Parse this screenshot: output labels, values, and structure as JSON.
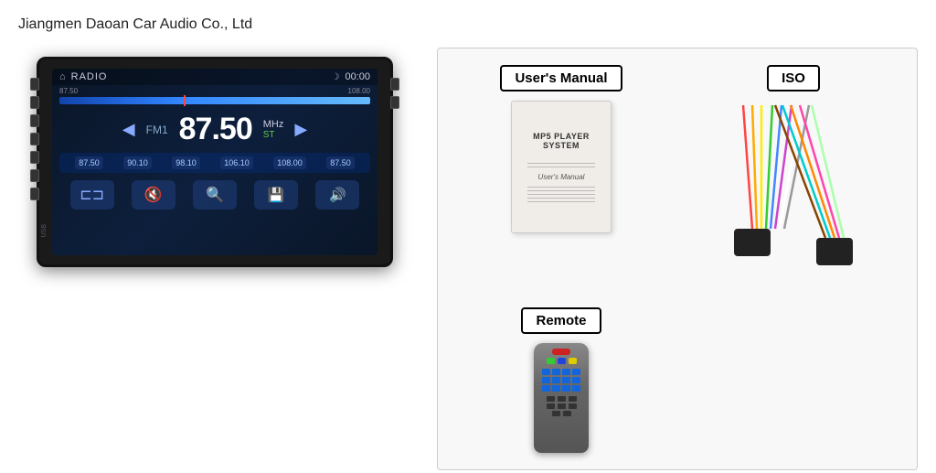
{
  "company": {
    "name": "Jiangmen Daoan Car Audio Co., Ltd"
  },
  "stereo": {
    "mode": "RADIO",
    "frequency": "87.50",
    "unit": "MHz",
    "st": "ST",
    "fm_label": "FM1",
    "time": "00:00",
    "freq_low": "87.50",
    "freq_high": "108.00",
    "presets": [
      "87.50",
      "90.10",
      "98.10",
      "106.10",
      "108.00",
      "87.50"
    ]
  },
  "accessories": {
    "manual_label": "User's Manual",
    "manual_title": "MP5 PLAYER SYSTEM",
    "manual_subtitle": "User's Manual",
    "iso_label": "ISO",
    "remote_label": "Remote"
  }
}
